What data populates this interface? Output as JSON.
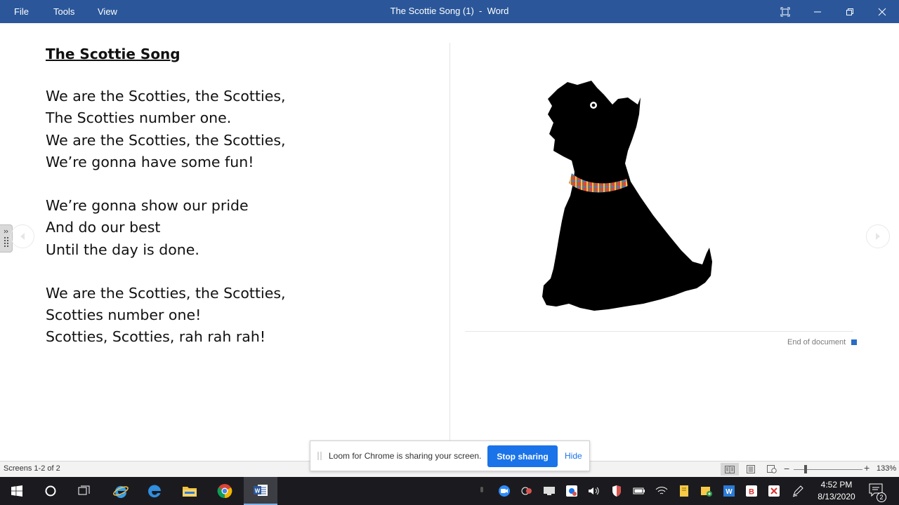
{
  "window": {
    "menu": {
      "file": "File",
      "tools": "Tools",
      "view": "View"
    },
    "title": "The Scottie Song (1)  -  Word"
  },
  "document": {
    "title": "The Scottie Song",
    "stanza1": [
      "We are the Scotties, the Scotties,",
      "The Scotties number one.",
      "We are the Scotties, the Scotties,",
      "We’re gonna have some fun!"
    ],
    "stanza2": [
      "We’re gonna show our pride",
      "And do our best",
      "Until the day is done."
    ],
    "stanza3": [
      "We are the Scotties, the Scotties,",
      "Scotties number one!",
      "Scotties, Scotties, rah rah rah!"
    ],
    "end_label": "End of document",
    "image": "scottie-dog-silhouette-with-plaid-collar"
  },
  "statusbar": {
    "screens": "Screens 1-2 of 2",
    "zoom": "133%"
  },
  "loom": {
    "message": "Loom for Chrome is sharing your screen.",
    "stop": "Stop sharing",
    "hide": "Hide"
  },
  "taskbar": {
    "apps": [
      "windows-start-icon",
      "cortana-icon",
      "task-view-icon",
      "internet-explorer-icon",
      "edge-icon",
      "file-explorer-icon",
      "chrome-icon",
      "word-icon"
    ],
    "clock_time": "4:52 PM",
    "clock_date": "8/13/2020",
    "notifications": "2"
  },
  "colors": {
    "titlebar": "#2b579a",
    "accent": "#1a73e8",
    "taskbar": "#1b1b1f"
  }
}
